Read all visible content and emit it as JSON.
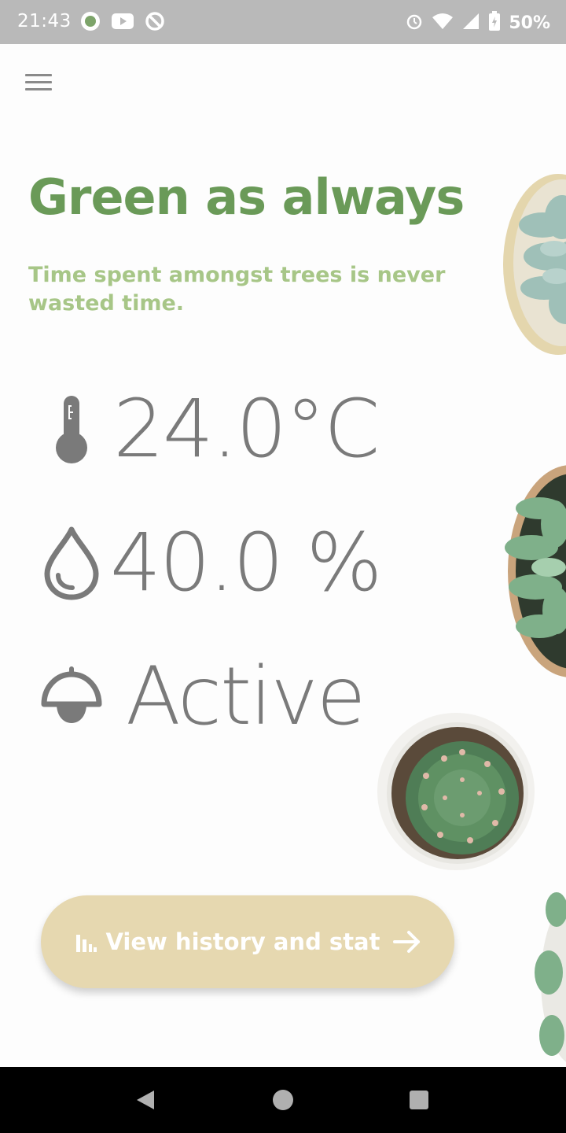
{
  "status_bar": {
    "time": "21:43",
    "battery_percent": "50%",
    "icons": [
      "app-notification-icon",
      "youtube-icon",
      "sync-icon",
      "alarm-icon",
      "wifi-icon",
      "cell-signal-icon",
      "battery-charging-icon"
    ]
  },
  "header": {
    "menu_icon": "hamburger-menu-icon"
  },
  "main": {
    "title": "Green as always",
    "subtitle": "Time spent amongst trees is never wasted time.",
    "readings": {
      "temperature": {
        "icon": "thermometer-icon",
        "value": "24.0°C"
      },
      "humidity": {
        "icon": "water-drop-icon",
        "value": "40.0 %"
      },
      "light": {
        "icon": "lamp-icon",
        "value": "Active"
      }
    },
    "history_button": {
      "icon": "bar-chart-icon",
      "label": "View history and stat",
      "arrow_icon": "arrow-right-icon"
    }
  },
  "nav_bar": {
    "buttons": [
      "back-icon",
      "home-icon",
      "recents-icon"
    ]
  },
  "colors": {
    "title": "#6a9a58",
    "subtitle": "#a7c687",
    "reading": "#7a7a7a",
    "button": "#e6d8b0",
    "status_bar": "#b9b9b9"
  }
}
